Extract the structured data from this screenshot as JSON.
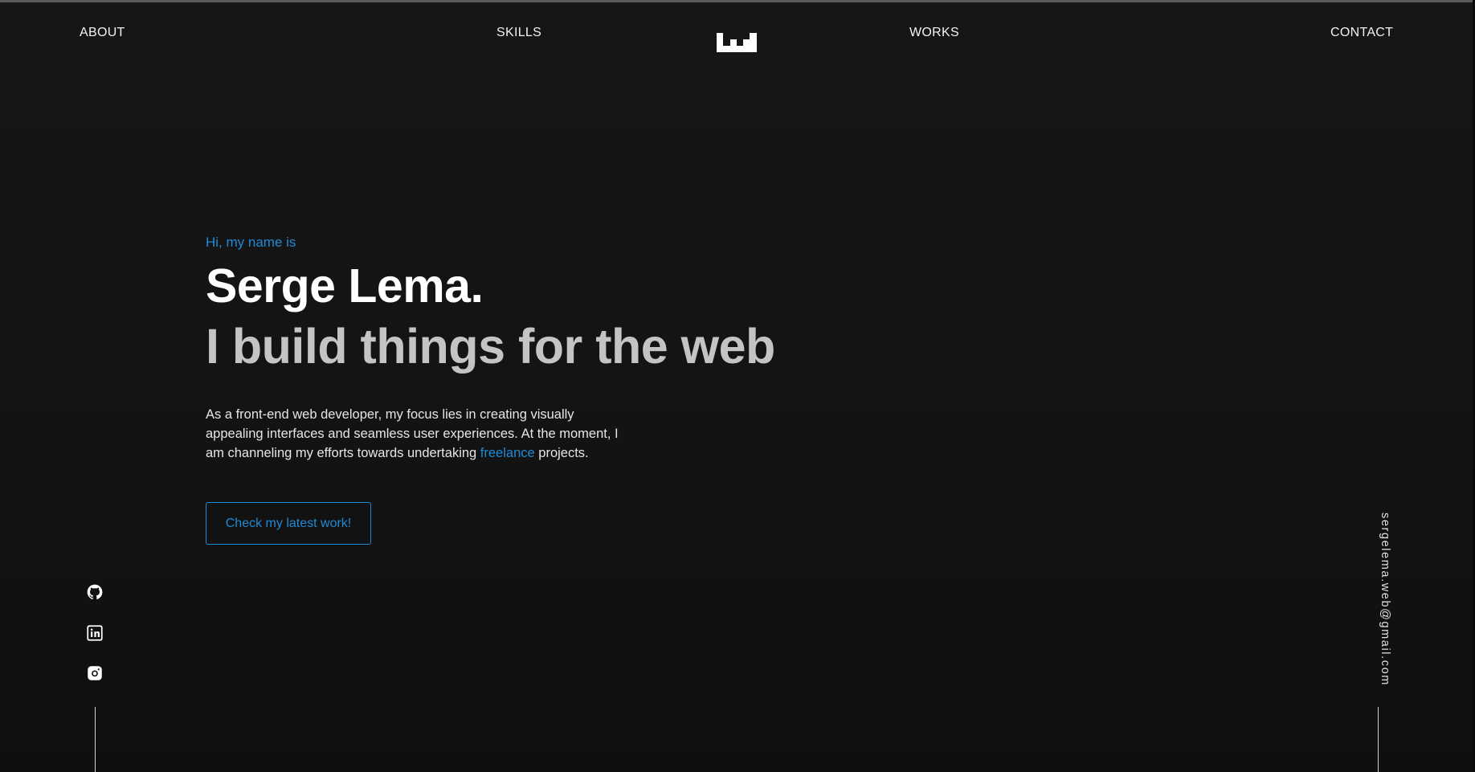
{
  "nav": {
    "about": "ABOUT",
    "skills": "SKILLS",
    "works": "WORKS",
    "contact": "CONTACT",
    "logo_icon": "wj-logo-icon"
  },
  "hero": {
    "greeting": "Hi, my name is",
    "name": "Serge Lema.",
    "tagline": "I build things for the web",
    "intro_before": "As a front-end web developer, my focus lies in creating visually appealing interfaces and seamless user experiences. At the moment, I am channeling my efforts towards undertaking ",
    "intro_link": "freelance",
    "intro_after": " projects.",
    "cta_label": "Check my latest work!"
  },
  "social": [
    {
      "name": "github",
      "icon": "github-icon"
    },
    {
      "name": "linkedin",
      "icon": "linkedin-icon"
    },
    {
      "name": "instagram",
      "icon": "instagram-icon"
    }
  ],
  "email": "sergelema.web@gmail.com",
  "colors": {
    "accent": "#1f8ad6",
    "background": "#141414",
    "text": "#f2f2f2",
    "tagline": "#c4c4c4"
  }
}
